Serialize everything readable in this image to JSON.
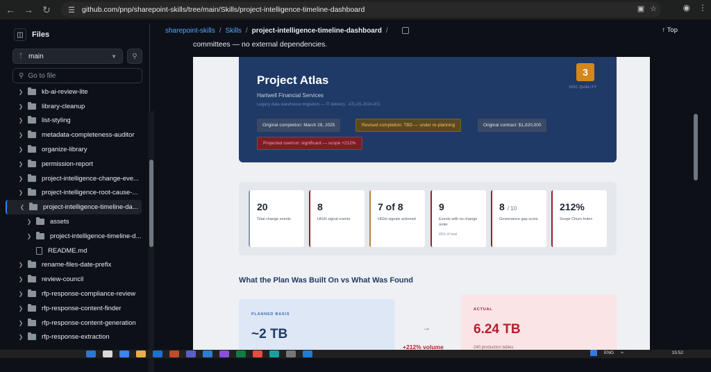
{
  "browser": {
    "url": "github.com/pnp/sharepoint-skills/tree/main/Skills/project-intelligence-timeline-dashboard"
  },
  "sidebar": {
    "title": "Files",
    "branch": "main",
    "goto_placeholder": "Go to file",
    "items": [
      {
        "label": "kb-ai-review-lite"
      },
      {
        "label": "library-cleanup"
      },
      {
        "label": "list-styling"
      },
      {
        "label": "metadata-completeness-auditor"
      },
      {
        "label": "organize-library"
      },
      {
        "label": "permission-report"
      },
      {
        "label": "project-intelligence-change-eve..."
      },
      {
        "label": "project-intelligence-root-cause-..."
      },
      {
        "label": "project-intelligence-timeline-da..."
      },
      {
        "label": "assets"
      },
      {
        "label": "project-intelligence-timeline-d..."
      },
      {
        "label": "README.md"
      },
      {
        "label": "rename-files-date-prefix"
      },
      {
        "label": "review-council"
      },
      {
        "label": "rfp-response-compliance-review"
      },
      {
        "label": "rfp-response-content-finder"
      },
      {
        "label": "rfp-response-content-generation"
      },
      {
        "label": "rfp-response-extraction"
      }
    ]
  },
  "breadcrumb": {
    "repo": "sharepoint-skills",
    "folder": "Skills",
    "current": "project-intelligence-timeline-dashboard",
    "top": "Top"
  },
  "intro": "committees — no external dependencies.",
  "dashboard": {
    "project": "Project Atlas",
    "client": "Hartwell Financial Services",
    "meta": "Legacy data warehouse migration — IT delivery · ATLAS-2024-001",
    "doc_quality_value": "3",
    "doc_quality_label": "DOC QUALITY",
    "pills": {
      "original_completion": "Original completion: March 28, 2025",
      "revised_completion": "Revised completion: TBD — under re-planning",
      "original_contract": "Original contract: $1,820,000",
      "overrun": "Projected overrun: significant — scope +212%"
    },
    "kpis": [
      {
        "value": "20",
        "label": "Total change events",
        "sub": ""
      },
      {
        "value": "8",
        "label": "HIGH signal events",
        "sub": ""
      },
      {
        "value": "7 of 8",
        "label": "HIGH signals actioned",
        "sub": ""
      },
      {
        "value": "9",
        "label": "Events with no change order",
        "sub": "45% of total"
      },
      {
        "value": "8",
        "unit": "/ 10",
        "label": "Governance gap score",
        "sub": ""
      },
      {
        "value": "212%",
        "label": "Scope Churn Index",
        "sub": ""
      }
    ],
    "section_title": "What the Plan Was Built On vs What Was Found",
    "planned": {
      "caption": "PLANNED BASIS",
      "value": "~2 TB"
    },
    "arrow": "→",
    "volume": "+212% volume",
    "actual": {
      "caption": "ACTUAL",
      "value": "6.24 TB",
      "sub": "240 production tables"
    }
  },
  "taskbar": {
    "lang": "ENG",
    "time": "15:52"
  },
  "colors": {
    "hero_bg": "#1f3a66",
    "accent_amber": "#d4871a",
    "accent_red": "#b3202c",
    "link_blue": "#58a6ff"
  }
}
